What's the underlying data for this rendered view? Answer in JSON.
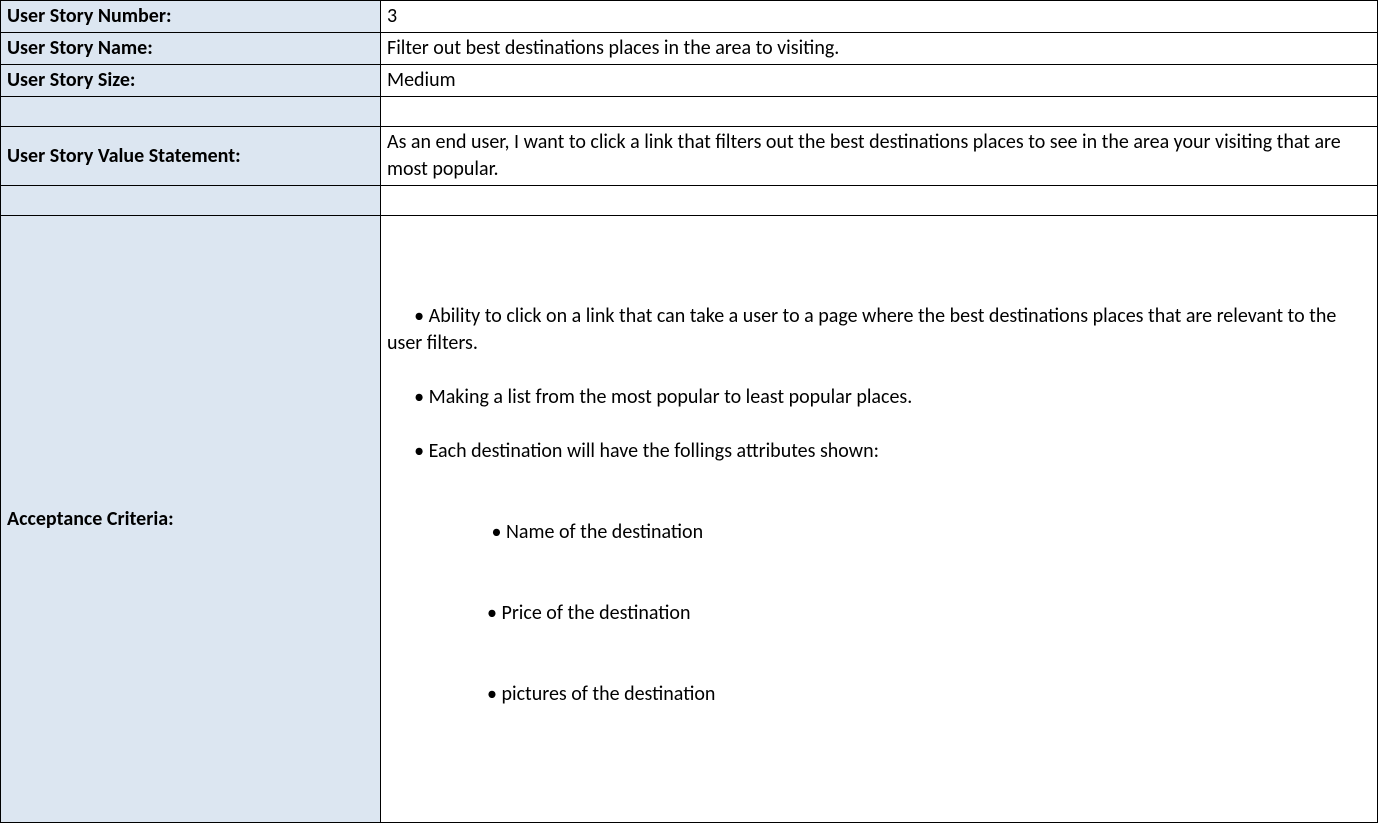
{
  "rows": {
    "number": {
      "label": "User Story Number:",
      "value": "3"
    },
    "name": {
      "label": "User Story Name:",
      "value": "Filter out best destinations places in the area to visiting."
    },
    "size": {
      "label": "User Story Size:",
      "value": "Medium"
    },
    "valueStatement": {
      "label": "User Story Value Statement:",
      "value": "As an end user,  I want to click a link that filters out the best destinations places to see in the area your visiting that are most popular."
    },
    "criteria": {
      "label": "Acceptance Criteria:",
      "line1": "• Ability to click on a link that can take a user to a page where the best destinations places that are relevant to the user filters.",
      "line2": "• Making a list from the most popular to least popular places.",
      "line3": "• Each destination will have the follings attributes shown:",
      "sub1": " • Name of the destination",
      "sub2": "• Price of the destination",
      "sub3": "• pictures of the destination"
    }
  }
}
